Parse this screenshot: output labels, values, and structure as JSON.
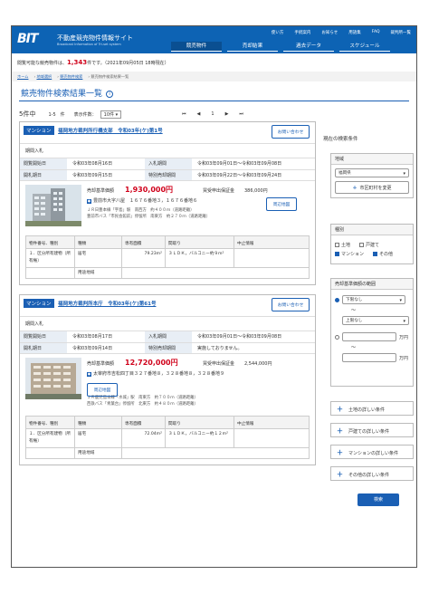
{
  "header": {
    "logo": "BIT",
    "site_title": "不動産競売物件情報サイト",
    "site_sub": "Broadcast Information of Tri-set system",
    "util_links": [
      "使い方",
      "手続案内",
      "お知らせ",
      "用語集",
      "FAQ",
      "裁判所一覧"
    ],
    "nav": [
      "競売物件",
      "売却結果",
      "過去データ",
      "スケジュール"
    ]
  },
  "notice": {
    "prefix": "閲覧可能な競売物件は、",
    "count": "1,343",
    "suffix": "件です。（2021年09月05日 18時現在）"
  },
  "breadcrumb": [
    "ホーム",
    "地域選択",
    "競売物件検索",
    "競売物件検索結果一覧"
  ],
  "page_title": "競売物件検索結果一覧",
  "pager": {
    "count": "5件中",
    "range": "1-5　件",
    "per_page_label": "表示件数：",
    "per_page": "10件",
    "first": "⏮",
    "prev": "◀",
    "page": "1",
    "next": "▶",
    "last": "⏭"
  },
  "results": [
    {
      "badge": "マンション",
      "case": "福岡地方裁判所行橋支部　令和03年(ケ)第1号",
      "inquire": "お問い合わせ",
      "kind": "期間入札",
      "rows": [
        {
          "l1": "閲覧開始日",
          "v1": "令和03年08月16日",
          "l2": "入札期間",
          "v2": "令和03年09月01日～令和03年09月08日"
        },
        {
          "l1": "開札期日",
          "v1": "令和03年09月15日",
          "l2": "特別売却期間",
          "v2": "令和03年09月22日～令和03年09月24日"
        }
      ],
      "price_label": "売却基準価額",
      "price": "1,930,000円",
      "deposit_label": "買受申出保証金",
      "deposit": "386,000円",
      "address": "豊前市大字八屋　１６７６番地３，１６７６番地６",
      "map_btn": "周辺地図",
      "access": [
        "ＪＲ日豊本線「宇島」駅　南西方　約４００ｍ（道路距離）",
        "豊前市バス「市民会館前」停留所　南東方　約２７０ｍ（道路距離）"
      ],
      "table_head": [
        "物件番号、種別",
        "種類",
        "専有面積",
        "間取り",
        "中止情報"
      ],
      "table_row": [
        "１．区分所有建物（所有権）",
        "居宅",
        "79.23m²",
        "３ＬＤＫ，バルコニー約９m²",
        ""
      ],
      "table_sub": "用途地域"
    },
    {
      "badge": "マンション",
      "case": "福岡地方裁判所本庁　令和03年(ケ)第61号",
      "inquire": "お問い合わせ",
      "kind": "期間入札",
      "rows": [
        {
          "l1": "閲覧開始日",
          "v1": "令和03年08月17日",
          "l2": "入札期間",
          "v2": "令和03年09月01日～令和03年09月08日"
        },
        {
          "l1": "開札期日",
          "v1": "令和03年09月14日",
          "l2": "特別売却期間",
          "v2": "実施しておりません。"
        }
      ],
      "price_label": "売却基準価額",
      "price": "12,720,000円",
      "deposit_label": "買受申出保証金",
      "deposit": "2,544,000円",
      "address": "太宰府市吉松四丁目３２７番地８，３２８番地８，３２８番地９",
      "map_btn": "周辺地図",
      "access": [
        "ＪＲ鹿児島本線「水城」駅　南東方　約７００ｍ（道路距離）",
        "西鉄バス「青葉台」停留所　北東方　約４８０ｍ（道路距離）"
      ],
      "table_head": [
        "物件番号、種別",
        "種類",
        "専有面積",
        "間取り",
        "中止情報"
      ],
      "table_row": [
        "１．区分所有建物（所有権）",
        "居宅",
        "72.04m²",
        "３ＬＤＫ，バルコニー約１２m²",
        ""
      ],
      "table_sub": "用途地域"
    }
  ],
  "sidebar": {
    "title": "現在の検索条件",
    "region_label": "地域",
    "region_value": "福岡県",
    "region_btn": "市区町村を変更",
    "type_label": "種別",
    "types": [
      {
        "label": "土地",
        "checked": false
      },
      {
        "label": "戸建て",
        "checked": false
      },
      {
        "label": "マンション",
        "checked": true
      },
      {
        "label": "その他",
        "checked": true
      }
    ],
    "price_label": "売却基準価額の範囲",
    "price_min": "下限なし",
    "tilde": "～",
    "price_max": "上限なし",
    "yen": "万円",
    "acc": [
      "土地の詳しい条件",
      "戸建ての詳しい条件",
      "マンションの詳しい条件",
      "その他の詳しい条件"
    ],
    "search_btn": "検索"
  }
}
